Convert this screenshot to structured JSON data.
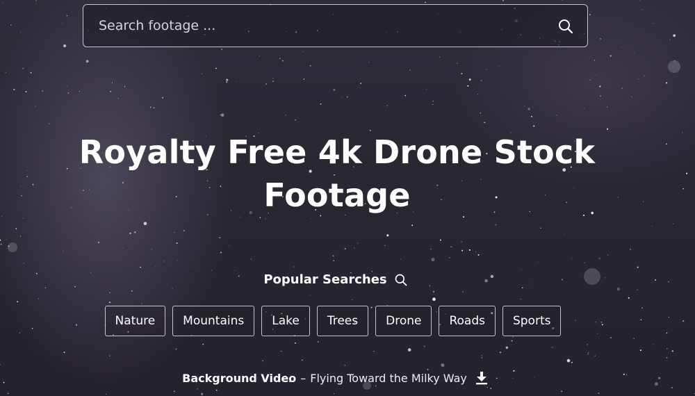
{
  "search": {
    "placeholder": "Search footage ...",
    "value": ""
  },
  "hero": {
    "title_line1": "Royalty Free 4k Drone Stock",
    "title_line2": "Footage"
  },
  "popular": {
    "label": "Popular Searches",
    "tags": [
      "Nature",
      "Mountains",
      "Lake",
      "Trees",
      "Drone",
      "Roads",
      "Sports"
    ]
  },
  "credit": {
    "label": "Background Video",
    "separator": "–",
    "title": "Flying Toward the Milky Way"
  },
  "icons": {
    "search": "search-icon",
    "popular": "search-icon",
    "download": "download-icon"
  },
  "colors": {
    "background": "#2a2632",
    "text": "#ffffff",
    "border": "#d9d9dc"
  }
}
